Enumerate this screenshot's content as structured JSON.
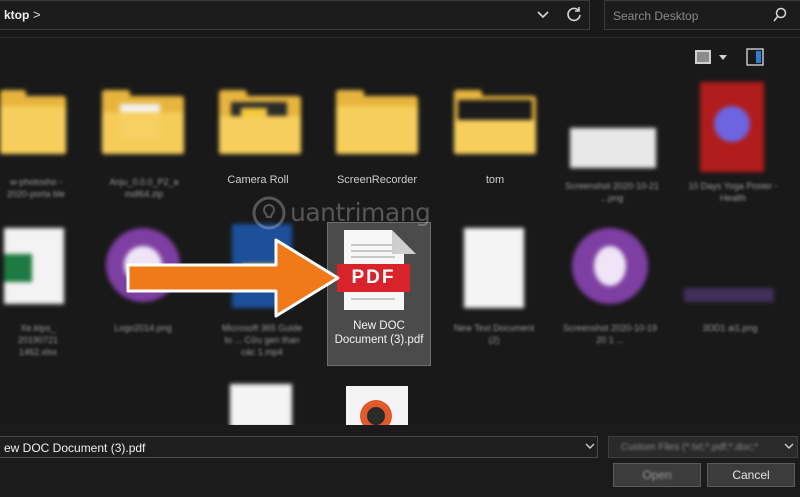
{
  "address_bar": {
    "path": "ktop",
    "separator": ">"
  },
  "search": {
    "placeholder": "Search Desktop"
  },
  "watermark": {
    "text": "uantrimang"
  },
  "items": [
    {
      "label": "Camera Roll"
    },
    {
      "label": "ScreenRecorder"
    },
    {
      "label": "tom"
    }
  ],
  "selected_file": {
    "label": "New DOC Document (3).pdf",
    "badge": "PDF"
  },
  "footer": {
    "filename": "ew DOC Document (3).pdf",
    "filetype": "Custom Files (*.txt;*.pdf;*.doc;*",
    "open_label": "Open",
    "cancel_label": "Cancel"
  },
  "colors": {
    "background": "#191919",
    "folder": "#f7ce5b",
    "pdf_red": "#d9232b",
    "arrow": "#f07a1a"
  }
}
